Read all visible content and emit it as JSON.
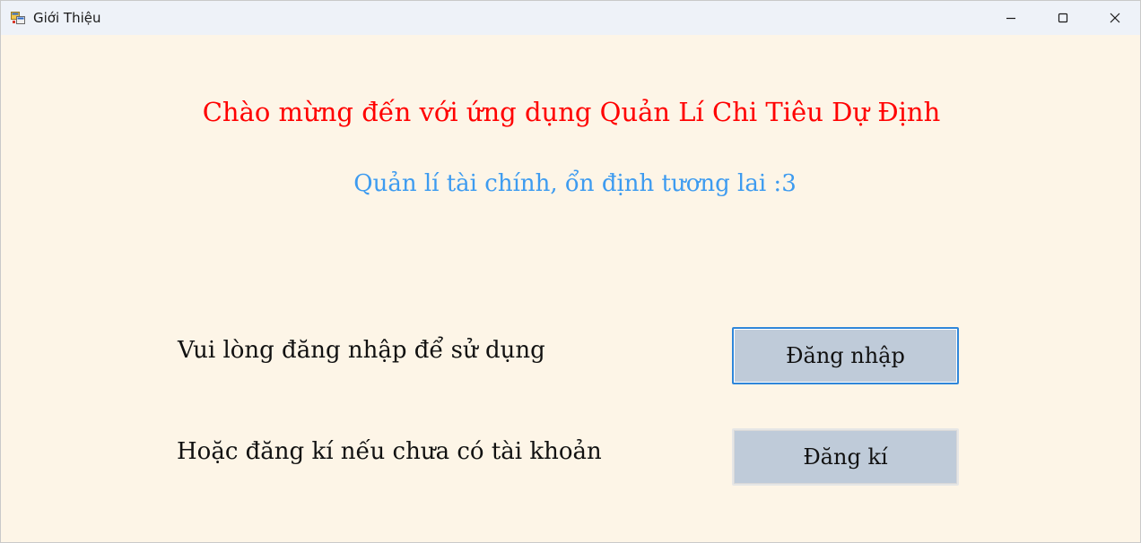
{
  "window": {
    "title": "Giới Thiệu",
    "controls": {
      "minimize": "minimize-icon",
      "maximize": "maximize-icon",
      "close": "close-icon"
    }
  },
  "main": {
    "heading": "Chào mừng đến với ứng dụng Quản Lí Chi Tiêu Dự Định",
    "subheading": "Quản lí tài chính, ổn định tương lai :3",
    "login_prompt": "Vui lòng đăng nhập để sử dụng",
    "register_prompt": "Hoặc đăng kí nếu chưa có tài khoản",
    "login_button": "Đăng nhập",
    "register_button": "Đăng kí"
  },
  "colors": {
    "background": "#fdf5e7",
    "heading": "#ff0000",
    "subheading": "#3d9bf0",
    "button": "#bfcbd9",
    "focus_border": "#2f86d9"
  }
}
